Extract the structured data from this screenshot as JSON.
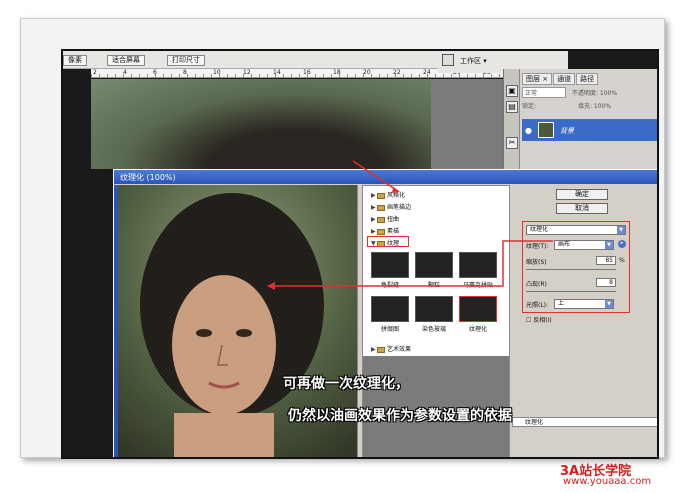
{
  "toolbar": {
    "btn_pixels": "像素",
    "btn_fit_screen": "适合屏幕",
    "btn_print_size": "打印尺寸",
    "workspace": "工作区 ▾"
  },
  "ruler": {
    "ticks": [
      "2",
      "4",
      "6",
      "8",
      "10",
      "12",
      "14",
      "16",
      "18",
      "20",
      "22",
      "24",
      "26",
      "28"
    ]
  },
  "layers_panel": {
    "tabs": [
      "图层 ×",
      "通道",
      "路径"
    ],
    "blend_mode": "正常",
    "opacity_label": "不透明度:",
    "opacity_value": "100%",
    "lock_label": "锁定:",
    "fill_label": "填充:",
    "fill_value": "100%",
    "layer_name": "背景"
  },
  "dialog": {
    "title": "纹理化 (100%)",
    "categories": [
      {
        "name": "风格化",
        "open": false
      },
      {
        "name": "画笔描边",
        "open": false
      },
      {
        "name": "扭曲",
        "open": false
      },
      {
        "name": "素描",
        "open": false
      },
      {
        "name": "纹理",
        "open": true
      }
    ],
    "thumbnails": [
      "龟裂缝",
      "颗粒",
      "马赛克拼贴",
      "拼缀图",
      "染色玻璃",
      "纹理化"
    ],
    "after_category": "艺术效果",
    "ok": "确定",
    "cancel": "取消",
    "filter_select": "纹理化",
    "texture_label": "纹理(T):",
    "texture_value": "画布",
    "scaling_label": "缩放(S)",
    "scaling_value": "85",
    "scaling_unit": "%",
    "relief_label": "凸现(R)",
    "relief_value": "8",
    "light_label": "光照(L):",
    "light_value": "上",
    "invert_label": "反相(I)",
    "layer_bottom": "纹理化"
  },
  "caption": {
    "line1": "可再做一次纹理化，",
    "line2": "仍然以油画效果作为参数设置的依据"
  },
  "watermark": {
    "line1": "3A站长学院",
    "line2": "www.youaaa.com"
  },
  "colors": {
    "annotation": "#e03030",
    "title_bar": "#2a54b8",
    "layer_selected": "#3a6bc8"
  }
}
